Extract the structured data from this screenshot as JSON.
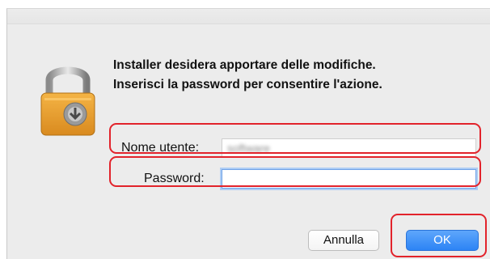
{
  "dialog": {
    "message_line1": "Installer desidera apportare delle modifiche.",
    "message_line2": "Inserisci la password per consentire l'azione."
  },
  "form": {
    "username_label": "Nome utente:",
    "username_value": "software",
    "password_label": "Password:",
    "password_value": ""
  },
  "buttons": {
    "cancel": "Annulla",
    "ok": "OK"
  },
  "colors": {
    "highlight": "#e2232b",
    "ok_button": "#2d84f5",
    "focus_ring": "#aecdf4"
  },
  "icons": {
    "lock": "padlock-with-installer-icon"
  }
}
